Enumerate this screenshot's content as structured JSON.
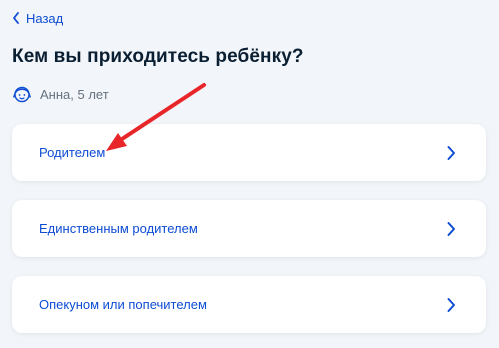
{
  "nav": {
    "back_label": "Назад"
  },
  "page": {
    "title": "Кем вы приходитесь ребёнку?"
  },
  "child": {
    "name": "Анна, 5 лет"
  },
  "options": [
    {
      "label": "Родителем"
    },
    {
      "label": "Единственным родителем"
    },
    {
      "label": "Опекуном или попечителем"
    }
  ],
  "icons": {
    "back": "chevron-left-icon",
    "child": "child-face-icon",
    "option_arrow": "chevron-right-icon",
    "annotation": "red-arrow-pointer"
  },
  "colors": {
    "accent": "#0d4cd3",
    "background": "#f2f5f9",
    "card": "#ffffff",
    "title": "#0b1f33",
    "muted": "#66727f",
    "annotation": "#e8262a"
  }
}
